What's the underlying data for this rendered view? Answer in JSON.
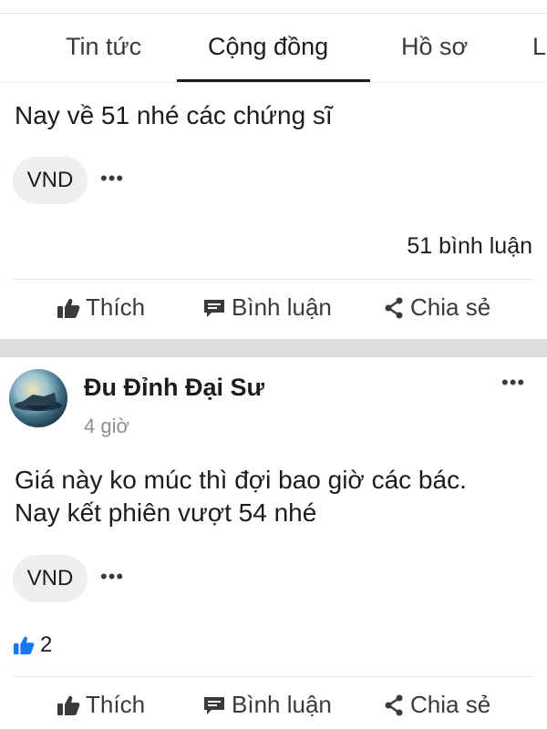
{
  "tabs": {
    "items": [
      "Tin tức",
      "Cộng đồng",
      "Hồ sơ"
    ],
    "active": "Cộng đồng"
  },
  "post1": {
    "text": "Nay về 51 nhé các chứng sĩ",
    "tag": "VND",
    "more": "•••",
    "comments_count": "51 bình luận",
    "actions": {
      "like": "Thích",
      "comment": "Bình luận",
      "share": "Chia sẻ"
    }
  },
  "post2": {
    "author": "Đu Đỉnh Đại Sư",
    "time": "4 giờ",
    "text_lines": [
      "Giá này ko múc thì đợi bao giờ các bác.",
      "Nay kết phiên vượt 54 nhé"
    ],
    "tag": "VND",
    "more": "•••",
    "header_more": "•••",
    "likes": "2",
    "actions": {
      "like": "Thích",
      "comment": "Bình luận",
      "share": "Chia sẻ"
    }
  },
  "colors": {
    "text": "#1c1c1e",
    "muted": "#8e8e93",
    "chip_bg": "#efefef",
    "like_blue": "#1877f2",
    "band": "#dcdcdc"
  }
}
